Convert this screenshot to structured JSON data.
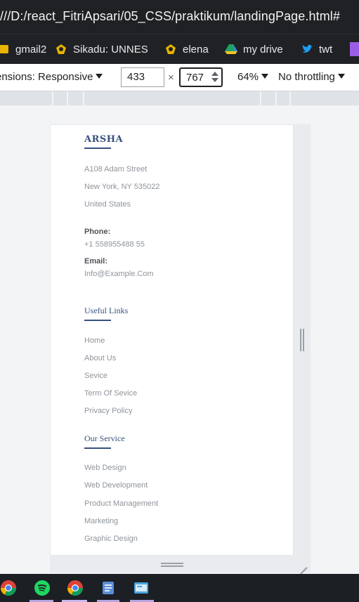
{
  "browser": {
    "url": "///D:/react_FitriApsari/05_CSS/praktikum/landingPage.html#",
    "bookmarks": [
      {
        "label": "gmail2",
        "icon": "bookmark-icon"
      },
      {
        "label": "Sikadu: UNNES",
        "icon": "unnes-icon"
      },
      {
        "label": "elena",
        "icon": "unnes-icon"
      },
      {
        "label": "my drive",
        "icon": "drive-icon"
      },
      {
        "label": "twt",
        "icon": "twitter-icon"
      }
    ]
  },
  "device_toolbar": {
    "dimensions_label": "ensions: Responsive",
    "width": "433",
    "times": "×",
    "height": "767",
    "zoom": "64%",
    "throttling": "No throttling"
  },
  "footer": {
    "brand": "ARSHA",
    "address_lines": [
      "A108 Adam Street",
      "New York, NY 535022",
      "United States"
    ],
    "phone_label": "Phone:",
    "phone": "+1 558955488 55",
    "email_label": "Email:",
    "email": "Info@Example.Com",
    "useful_links_title": "Useful Links",
    "useful_links": [
      "Home",
      "About Us",
      "Sevice",
      "Term Of Sevice",
      "Privacy Policy"
    ],
    "services_title": "Our Service",
    "services": [
      "Web Design",
      "Web Development",
      "Product Management",
      "Marketing",
      "Graphic Design"
    ]
  },
  "taskbar": {
    "apps": [
      "chrome-icon",
      "spotify-icon",
      "chrome-icon",
      "notes-icon",
      "explorer-icon"
    ]
  },
  "colors": {
    "accent": "#37517e",
    "chrome_dark": "#202124"
  }
}
